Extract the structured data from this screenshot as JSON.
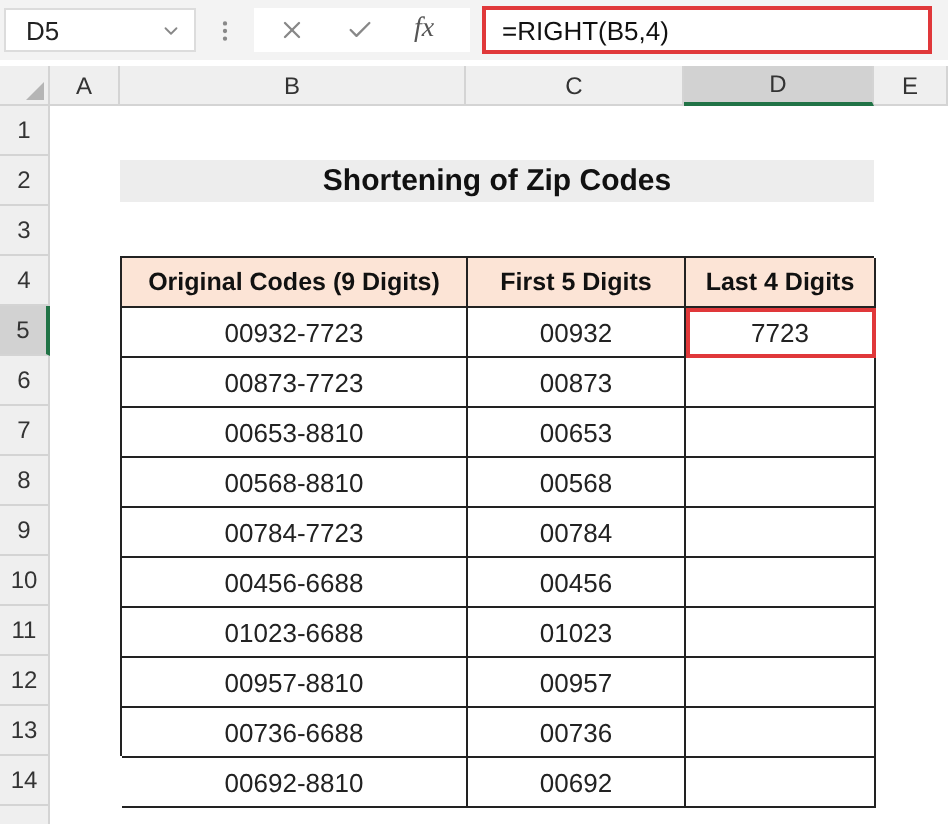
{
  "name_box": {
    "value": "D5"
  },
  "formula_bar": {
    "function_label": "fx",
    "formula": "=RIGHT(B5,4)"
  },
  "column_headers": [
    {
      "label": "A",
      "selected": false
    },
    {
      "label": "B",
      "selected": false
    },
    {
      "label": "C",
      "selected": false
    },
    {
      "label": "D",
      "selected": true
    },
    {
      "label": "E",
      "selected": false
    }
  ],
  "row_headers": [
    {
      "label": "1",
      "selected": false
    },
    {
      "label": "2",
      "selected": false
    },
    {
      "label": "3",
      "selected": false
    },
    {
      "label": "4",
      "selected": false
    },
    {
      "label": "5",
      "selected": true
    },
    {
      "label": "6",
      "selected": false
    },
    {
      "label": "7",
      "selected": false
    },
    {
      "label": "8",
      "selected": false
    },
    {
      "label": "9",
      "selected": false
    },
    {
      "label": "10",
      "selected": false
    },
    {
      "label": "11",
      "selected": false
    },
    {
      "label": "12",
      "selected": false
    },
    {
      "label": "13",
      "selected": false
    },
    {
      "label": "14",
      "selected": false
    }
  ],
  "title": "Shortening of Zip Codes",
  "table": {
    "columns": [
      "Original Codes (9 Digits)",
      "First 5 Digits",
      "Last 4 Digits"
    ],
    "rows": [
      {
        "original": "00932-7723",
        "first5": "00932",
        "last4": "7723",
        "last4_selected": true
      },
      {
        "original": "00873-7723",
        "first5": "00873",
        "last4_selected": false
      },
      {
        "original": "00653-8810",
        "first5": "00653",
        "last4_selected": false
      },
      {
        "original": "00568-8810",
        "first5": "00568",
        "last4_selected": false
      },
      {
        "original": "00784-7723",
        "first5": "00784",
        "last4_selected": false
      },
      {
        "original": "00456-6688",
        "first5": "00456",
        "last4_selected": false
      },
      {
        "original": "01023-6688",
        "first5": "01023",
        "last4_selected": false
      },
      {
        "original": "00957-8810",
        "first5": "00957",
        "last4_selected": false
      },
      {
        "original": "00736-6688",
        "first5": "00736",
        "last4_selected": false
      },
      {
        "original": "00692-8810",
        "first5": "00692",
        "last4_selected": false
      }
    ]
  }
}
